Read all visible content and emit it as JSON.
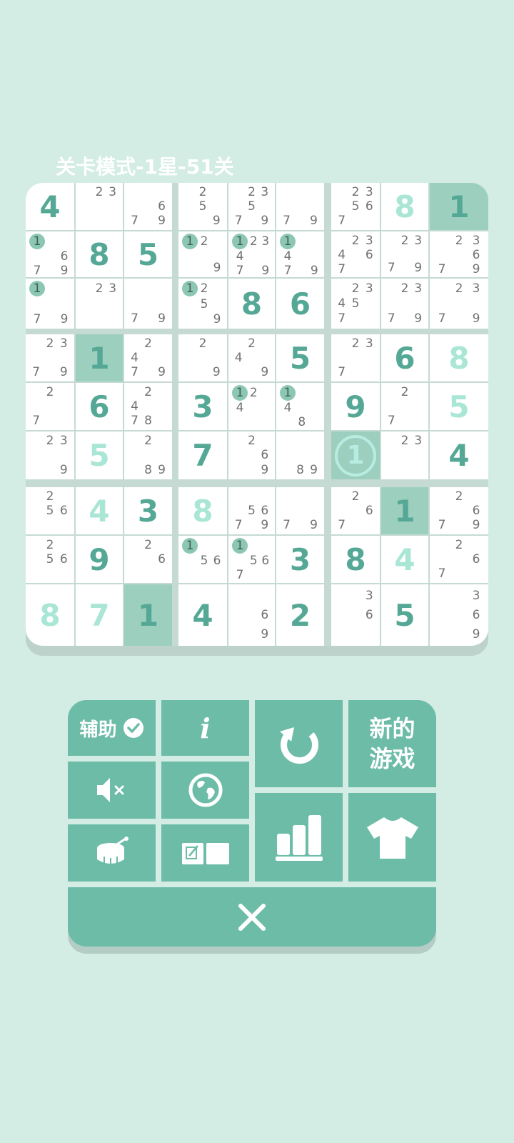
{
  "level_title": "关卡模式-1星-51关",
  "grid": [
    [
      {
        "v": "4",
        "t": "g"
      },
      {
        "c": [
          "",
          "2",
          "3",
          "",
          "",
          "",
          "",
          "",
          ""
        ]
      },
      {
        "c": [
          "",
          "",
          "",
          "",
          "",
          "6",
          "7",
          "",
          "9"
        ]
      },
      {
        "c": [
          "",
          "2",
          "",
          "",
          "5",
          "",
          "",
          "",
          "9"
        ]
      },
      {
        "c": [
          "",
          "2",
          "3",
          "",
          "5",
          "",
          "7",
          "",
          "9"
        ]
      },
      {
        "c": [
          "",
          "",
          "",
          "",
          "",
          "",
          "7",
          "",
          "9"
        ]
      },
      {
        "c": [
          "",
          "2",
          "3",
          "",
          "5",
          "6",
          "7",
          "",
          ""
        ]
      },
      {
        "v": "8",
        "t": "u"
      },
      {
        "v": "1",
        "t": "g",
        "hl": true
      }
    ],
    [
      {
        "c": [
          "1",
          "",
          "",
          "",
          "",
          "6",
          "7",
          "",
          "9"
        ],
        "m": [
          0
        ]
      },
      {
        "v": "8",
        "t": "g"
      },
      {
        "v": "5",
        "t": "g"
      },
      {
        "c": [
          "1",
          "2",
          "",
          "",
          "",
          "",
          "",
          "",
          "9"
        ],
        "m": [
          0
        ]
      },
      {
        "c": [
          "1",
          "2",
          "3",
          "4",
          "",
          "",
          "7",
          "",
          "9"
        ],
        "m": [
          0
        ]
      },
      {
        "c": [
          "1",
          "",
          "",
          "4",
          "",
          "",
          "7",
          "",
          "9"
        ],
        "m": [
          0
        ]
      },
      {
        "c": [
          "",
          "2",
          "3",
          "4",
          "",
          "6",
          "7",
          "",
          ""
        ]
      },
      {
        "c": [
          "",
          "2",
          "3",
          "",
          "",
          "",
          "7",
          "",
          "9"
        ]
      },
      {
        "c": [
          "",
          "2",
          "3",
          "",
          "",
          "6",
          "7",
          "",
          "9"
        ]
      }
    ],
    [
      {
        "c": [
          "1",
          "",
          "",
          "",
          "",
          "",
          "7",
          "",
          "9"
        ],
        "m": [
          0
        ]
      },
      {
        "c": [
          "",
          "2",
          "3",
          "",
          "",
          "",
          "",
          "",
          ""
        ]
      },
      {
        "c": [
          "",
          "",
          "",
          "",
          "",
          "",
          "7",
          "",
          "9"
        ]
      },
      {
        "c": [
          "1",
          "2",
          "",
          "",
          "5",
          "",
          "",
          "",
          "9"
        ],
        "m": [
          0
        ]
      },
      {
        "v": "8",
        "t": "g"
      },
      {
        "v": "6",
        "t": "g"
      },
      {
        "c": [
          "",
          "2",
          "3",
          "4",
          "5",
          "",
          "7",
          "",
          ""
        ]
      },
      {
        "c": [
          "",
          "2",
          "3",
          "",
          "",
          "",
          "7",
          "",
          "9"
        ]
      },
      {
        "c": [
          "",
          "2",
          "3",
          "",
          "",
          "",
          "7",
          "",
          "9"
        ]
      }
    ],
    [
      {
        "c": [
          "",
          "2",
          "3",
          "",
          "",
          "",
          "7",
          "",
          "9"
        ]
      },
      {
        "v": "1",
        "t": "g",
        "hl": true
      },
      {
        "c": [
          "",
          "2",
          "",
          "4",
          "",
          "",
          "7",
          "",
          "9"
        ]
      },
      {
        "c": [
          "",
          "2",
          "",
          "",
          "",
          "",
          "",
          "",
          "9"
        ]
      },
      {
        "c": [
          "",
          "2",
          "",
          "4",
          "",
          "",
          "",
          "",
          "9"
        ]
      },
      {
        "v": "5",
        "t": "g"
      },
      {
        "c": [
          "",
          "2",
          "3",
          "",
          "",
          "",
          "7",
          "",
          ""
        ]
      },
      {
        "v": "6",
        "t": "g"
      },
      {
        "v": "8",
        "t": "u"
      }
    ],
    [
      {
        "c": [
          "",
          "2",
          "",
          "",
          "",
          "",
          "7",
          "",
          ""
        ]
      },
      {
        "v": "6",
        "t": "g"
      },
      {
        "c": [
          "",
          "2",
          "",
          "4",
          "",
          "",
          "7",
          "8",
          ""
        ]
      },
      {
        "v": "3",
        "t": "g"
      },
      {
        "c": [
          "1",
          "2",
          "",
          "4",
          "",
          "",
          "",
          "",
          ""
        ],
        "m": [
          0
        ]
      },
      {
        "c": [
          "1",
          "",
          "",
          "4",
          "",
          "",
          "",
          "8",
          ""
        ],
        "m": [
          0
        ]
      },
      {
        "v": "9",
        "t": "g"
      },
      {
        "c": [
          "",
          "2",
          "",
          "",
          "",
          "",
          "7",
          "",
          ""
        ]
      },
      {
        "v": "5",
        "t": "u"
      }
    ],
    [
      {
        "c": [
          "",
          "2",
          "3",
          "",
          "",
          "",
          "",
          "",
          "9"
        ]
      },
      {
        "v": "5",
        "t": "u"
      },
      {
        "c": [
          "",
          "2",
          "",
          "",
          "",
          "",
          "",
          "8",
          "9"
        ]
      },
      {
        "v": "7",
        "t": "g"
      },
      {
        "c": [
          "",
          "2",
          "",
          "",
          "",
          "6",
          "",
          "",
          "9"
        ]
      },
      {
        "c": [
          "",
          "",
          "",
          "",
          "",
          "",
          "",
          "8",
          "9"
        ]
      },
      {
        "v": "1",
        "t": "c",
        "hl": true
      },
      {
        "c": [
          "",
          "2",
          "3",
          "",
          "",
          "",
          "",
          "",
          ""
        ]
      },
      {
        "v": "4",
        "t": "g"
      }
    ],
    [
      {
        "c": [
          "",
          "2",
          "",
          "",
          "5",
          "6",
          "",
          "",
          ""
        ]
      },
      {
        "v": "4",
        "t": "u"
      },
      {
        "v": "3",
        "t": "g"
      },
      {
        "v": "8",
        "t": "u"
      },
      {
        "c": [
          "",
          "",
          "",
          "",
          "5",
          "6",
          "7",
          "",
          "9"
        ]
      },
      {
        "c": [
          "",
          "",
          "",
          "",
          "",
          "",
          "7",
          "",
          "9"
        ]
      },
      {
        "c": [
          "",
          "2",
          "",
          "",
          "",
          "6",
          "7",
          "",
          ""
        ]
      },
      {
        "v": "1",
        "t": "g",
        "hl": true
      },
      {
        "c": [
          "",
          "2",
          "",
          "",
          "",
          "6",
          "7",
          "",
          "9"
        ]
      }
    ],
    [
      {
        "c": [
          "",
          "2",
          "",
          "",
          "5",
          "6",
          "",
          "",
          ""
        ]
      },
      {
        "v": "9",
        "t": "g"
      },
      {
        "c": [
          "",
          "2",
          "",
          "",
          "",
          "6",
          "",
          "",
          ""
        ]
      },
      {
        "c": [
          "1",
          "",
          "",
          "",
          "5",
          "6",
          "",
          "",
          ""
        ],
        "m": [
          0
        ]
      },
      {
        "c": [
          "1",
          "",
          "",
          "",
          "5",
          "6",
          "7",
          "",
          ""
        ],
        "m": [
          0
        ]
      },
      {
        "v": "3",
        "t": "g"
      },
      {
        "v": "8",
        "t": "g"
      },
      {
        "v": "4",
        "t": "u"
      },
      {
        "c": [
          "",
          "2",
          "",
          "",
          "",
          "6",
          "7",
          "",
          ""
        ]
      }
    ],
    [
      {
        "v": "8",
        "t": "u"
      },
      {
        "v": "7",
        "t": "u"
      },
      {
        "v": "1",
        "t": "g",
        "hl": true
      },
      {
        "v": "4",
        "t": "g"
      },
      {
        "c": [
          "",
          "",
          "",
          "",
          "",
          "6",
          "",
          "",
          "9"
        ]
      },
      {
        "v": "2",
        "t": "g"
      },
      {
        "c": [
          "",
          "",
          "3",
          "",
          "",
          "6",
          "",
          "",
          ""
        ]
      },
      {
        "v": "5",
        "t": "g"
      },
      {
        "c": [
          "",
          "",
          "3",
          "",
          "",
          "6",
          "",
          "",
          "9"
        ]
      }
    ]
  ],
  "buttons": {
    "assist_label": "辅助",
    "info_label": "i",
    "new_game_line1": "新的",
    "new_game_line2": "游戏"
  },
  "icons": [
    "check-circle-icon",
    "info-icon",
    "refresh-icon",
    "mute-icon",
    "globe-icon",
    "drum-icon",
    "notebook-icon",
    "stats-icon",
    "shirt-icon",
    "close-icon"
  ],
  "colors": {
    "background": "#d3ece4",
    "button": "#6cbca8",
    "given_digit": "#55a895",
    "user_digit": "#a9e6d5",
    "highlight": "#9ccfbe"
  }
}
